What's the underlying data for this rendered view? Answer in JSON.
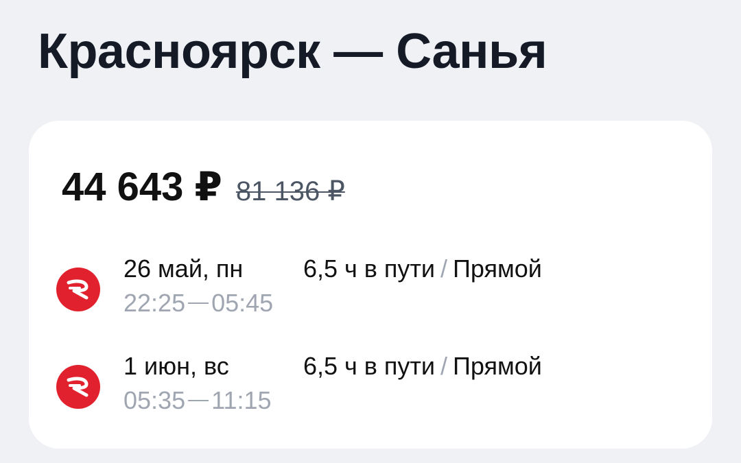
{
  "route": {
    "title": "Красноярск — Санья"
  },
  "offer": {
    "price": "44 643 ₽",
    "old_price": "81 136 ₽"
  },
  "segments": [
    {
      "date": "26 май, пн",
      "departure": "22:25",
      "arrival": "05:45",
      "duration": "6,5 ч в пути",
      "separator": "/",
      "type": "Прямой",
      "airline_icon": "airline-logo-red-circle"
    },
    {
      "date": "1 июн, вс",
      "departure": "05:35",
      "arrival": "11:15",
      "duration": "6,5 ч в пути",
      "separator": "/",
      "type": "Прямой",
      "airline_icon": "airline-logo-red-circle"
    }
  ],
  "colors": {
    "background": "#eff1f5",
    "card": "#ffffff",
    "airline_red": "#e1222e",
    "muted_text": "#a0a6b1"
  }
}
